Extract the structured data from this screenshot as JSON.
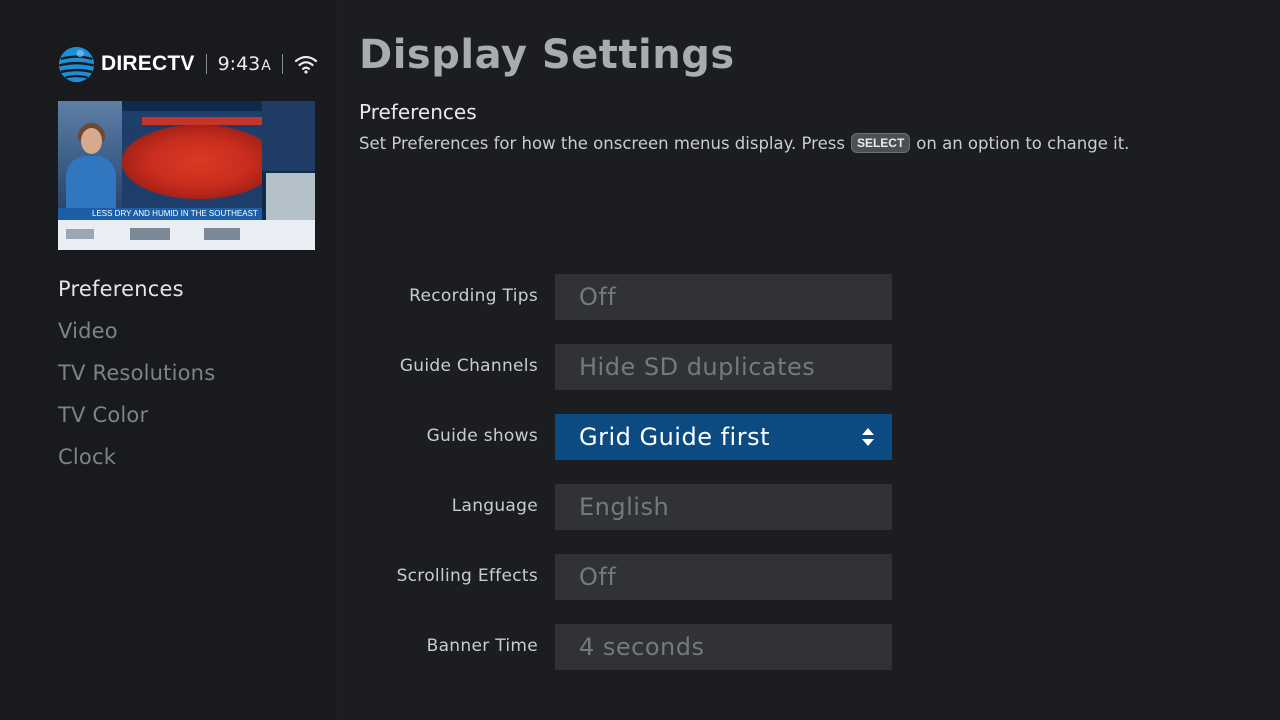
{
  "header": {
    "brand": "DIRECTV",
    "time": "9:43",
    "time_suffix": "A",
    "brand_logo_icon": "att-globe-icon",
    "status_icon": "wifi-icon"
  },
  "preview": {
    "lower_third": "LESS DRY AND HUMID IN THE SOUTHEAST"
  },
  "sidebar": {
    "items": [
      {
        "label": "Preferences",
        "active": true
      },
      {
        "label": "Video",
        "active": false
      },
      {
        "label": "TV Resolutions",
        "active": false
      },
      {
        "label": "TV Color",
        "active": false
      },
      {
        "label": "Clock",
        "active": false
      }
    ]
  },
  "page": {
    "title": "Display Settings",
    "section": "Preferences",
    "description_before": "Set Preferences for how the onscreen menus display. Press",
    "description_key": "SELECT",
    "description_after": "on an option to change it."
  },
  "settings": [
    {
      "label": "Recording Tips",
      "value": "Off",
      "focused": false
    },
    {
      "label": "Guide Channels",
      "value": "Hide SD duplicates",
      "focused": false
    },
    {
      "label": "Guide shows",
      "value": "Grid Guide first",
      "focused": true
    },
    {
      "label": "Language",
      "value": "English",
      "focused": false
    },
    {
      "label": "Scrolling Effects",
      "value": "Off",
      "focused": false
    },
    {
      "label": "Banner Time",
      "value": "4 seconds",
      "focused": false
    }
  ],
  "colors": {
    "focus": "#0c4a82",
    "background": "#1b1d21",
    "brand_blue": "#1e8fd6"
  }
}
